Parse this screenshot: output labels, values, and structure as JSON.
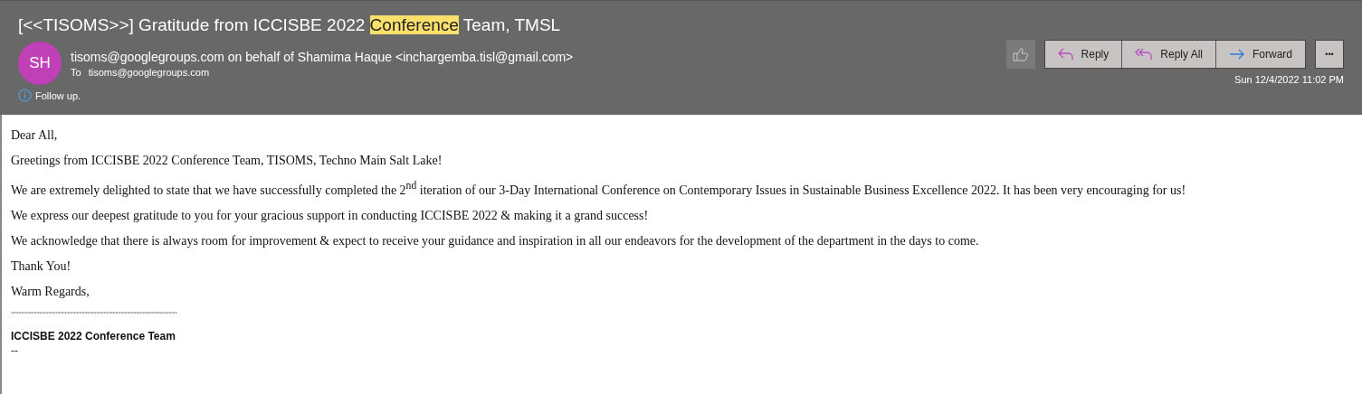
{
  "subject": [
    {
      "text": "[<<TISOMS>>] Gratitude from ICCISBE 2022 ",
      "highlighted": false
    },
    {
      "text": "Conference",
      "highlighted": true
    },
    {
      "text": " Team, TMSL",
      "highlighted": false
    }
  ],
  "sender": {
    "initials": "SH",
    "color": "#c040b8",
    "from": "tisoms@googlegroups.com on behalf of Shamima Haque <inchargemba.tisl@gmail.com>",
    "to_label": "To",
    "to": "tisoms@googlegroups.com"
  },
  "info": "Follow up.",
  "actions": [
    {
      "label": "Reply",
      "kind": "reply"
    },
    {
      "label": "Reply All",
      "kind": "replyall"
    },
    {
      "label": "Forward",
      "kind": "forward"
    }
  ],
  "more": "•••",
  "date": "Sun 12/4/2022 11:02 PM",
  "body": [
    "Dear  All,",
    "Greetings from ICCISBE 2022 Conference Team, TISOMS, Techno Main Salt Lake!",
    "We are extremely delighted to state that we have successfully completed the 2$^{nd}$ iteration of our 3-Day International Conference on Contemporary Issues in Sustainable Business Excellence 2022.  It has been very encouraging for us!",
    "We express our deepest gratitude to you for your gracious support in conducting ICCISBE 2022  & making it a grand success!",
    "We acknowledge that there is always room for improvement & expect to receive your guidance and inspiration in all our endeavors for the development of the department in the days to come.",
    "Thank You!",
    "Warm Regards,"
  ],
  "separator": "~~~~~~~~~~~~~~~~~~~~~~~~~~~~~~~~~~~~~~~~~~~~~~~~~~~~~~~",
  "signature": "ICCISBE 2022 Conference Team",
  "sig_dash": "--"
}
